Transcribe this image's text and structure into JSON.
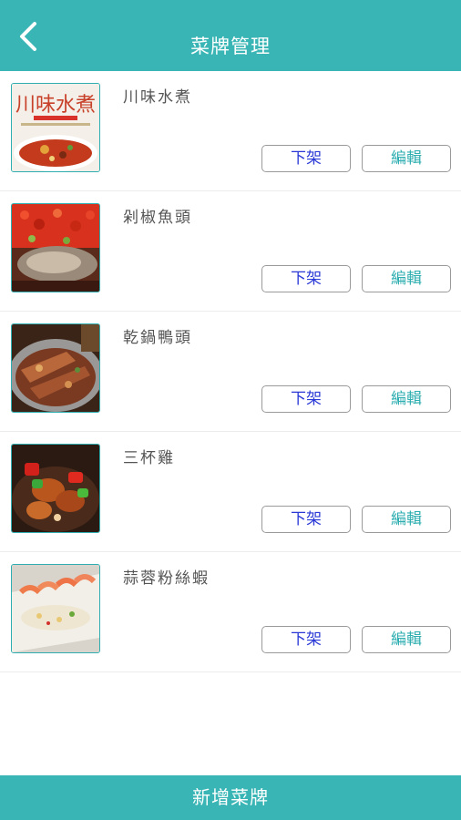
{
  "header": {
    "title": "菜牌管理",
    "back_icon": "chevron-left-icon"
  },
  "dishes": [
    {
      "name": "川味水煮",
      "unlist_label": "下架",
      "edit_label": "編輯",
      "thumb_text": "川味水煮"
    },
    {
      "name": "剁椒魚頭",
      "unlist_label": "下架",
      "edit_label": "編輯"
    },
    {
      "name": "乾鍋鴨頭",
      "unlist_label": "下架",
      "edit_label": "編輯"
    },
    {
      "name": "三杯雞",
      "unlist_label": "下架",
      "edit_label": "編輯"
    },
    {
      "name": "蒜蓉粉絲蝦",
      "unlist_label": "下架",
      "edit_label": "編輯"
    }
  ],
  "footer": {
    "add_label": "新增菜牌"
  },
  "colors": {
    "accent": "#39b5b5",
    "unlist_text": "#2a38d6",
    "edit_text": "#2eaeb0"
  }
}
